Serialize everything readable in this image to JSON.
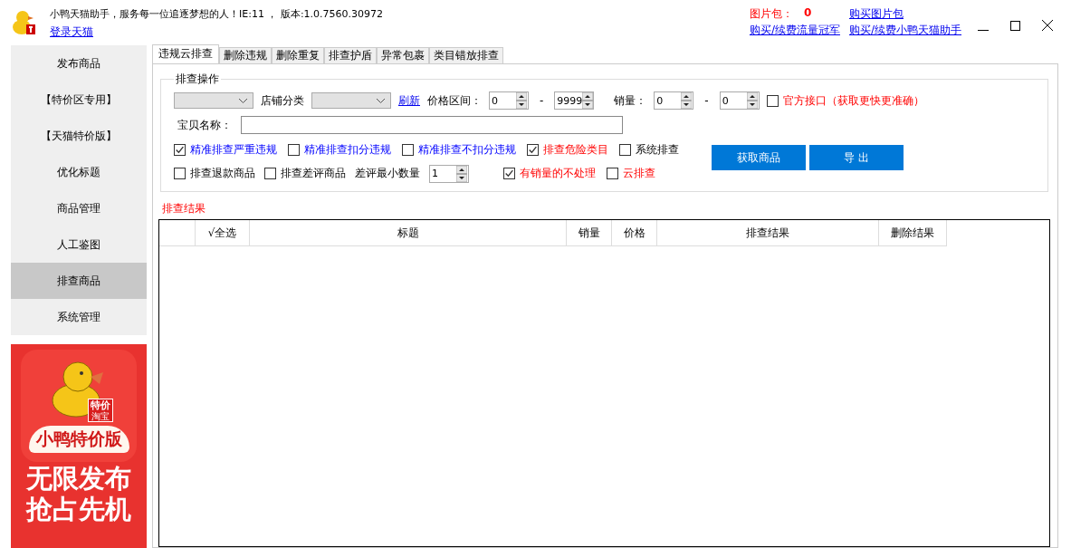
{
  "header": {
    "title": "小鸭天猫助手，服务每一位追逐梦想的人！IE:11 ， 版本:1.0.7560.30972",
    "login_link": "登录天猫",
    "image_pack_label": "图片包：",
    "image_pack_count": "0",
    "links": [
      "购买图片包",
      "购买/续费流量冠军",
      "购买/续费小鸭天猫助手"
    ]
  },
  "sidebar": {
    "items": [
      {
        "label": "发布商品",
        "selected": false
      },
      {
        "label": "【特价区专用】",
        "selected": false
      },
      {
        "label": "【天猫特价版】",
        "selected": false
      },
      {
        "label": "优化标题",
        "selected": false
      },
      {
        "label": "商品管理",
        "selected": false
      },
      {
        "label": "人工鉴图",
        "selected": false
      },
      {
        "label": "排查商品",
        "selected": true
      },
      {
        "label": "系统管理",
        "selected": false
      }
    ],
    "banner": {
      "app_name": "小鸭特价版",
      "badge": "特价",
      "badge_sub": "淘宝",
      "slogans": [
        "无限发布",
        "抢占先机"
      ]
    }
  },
  "tabs": [
    {
      "label": "违规云排查",
      "selected": true
    },
    {
      "label": "删除违规",
      "selected": false
    },
    {
      "label": "删除重复",
      "selected": false
    },
    {
      "label": "排查护盾",
      "selected": false
    },
    {
      "label": "异常包裹",
      "selected": false
    },
    {
      "label": "类目错放排查",
      "selected": false
    }
  ],
  "operations": {
    "title": "排查操作",
    "shop_category_label": "店铺分类",
    "refresh_link": "刷新",
    "price_label": "价格区间：",
    "price_min": "0",
    "price_max": "9999",
    "range_sep": [
      "-",
      "-"
    ],
    "sales_label": "销量：",
    "sales_min": "0",
    "sales_max": "0",
    "official_api": {
      "label": "官方接口（获取更快更准确）",
      "checked": false,
      "kind": "warning"
    },
    "item_name_label": "宝贝名称：",
    "checks_row1": [
      {
        "label": "精准排查严重违规",
        "checked": true,
        "kind": "precise"
      },
      {
        "label": "精准排查扣分违规",
        "checked": false,
        "kind": "precise"
      },
      {
        "label": "精准排查不扣分违规",
        "checked": false,
        "kind": "precise"
      },
      {
        "label": "排查危险类目",
        "checked": true,
        "kind": "warning"
      },
      {
        "label": "系统排查",
        "checked": false,
        "kind": "plain"
      }
    ],
    "checks_row2a": [
      {
        "label": "排查退款商品",
        "checked": false,
        "kind": "plain"
      },
      {
        "label": "排查差评商品",
        "checked": false,
        "kind": "plain"
      }
    ],
    "min_bad_label": "差评最小数量",
    "min_bad_value": "1",
    "checks_row2b": [
      {
        "label": "有销量的不处理",
        "checked": true,
        "kind": "warning"
      },
      {
        "label": "云排查",
        "checked": false,
        "kind": "warning"
      }
    ],
    "buttons": [
      "获取商品",
      "导 出"
    ]
  },
  "results": {
    "title": "排查结果",
    "columns": [
      "",
      "√全选",
      "标题",
      "销量",
      "价格",
      "排查结果",
      "删除结果"
    ]
  }
}
